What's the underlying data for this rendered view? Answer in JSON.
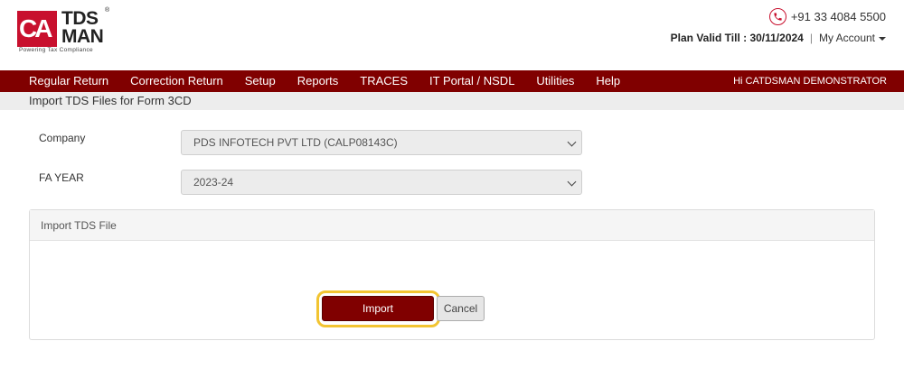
{
  "brand": {
    "logo_ca": "CA",
    "logo_tds": "TDS",
    "logo_man": "MAN",
    "logo_reg": "®",
    "tagline": "Powering Tax Compliance",
    "color": "#c8102e"
  },
  "header": {
    "phone": "+91 33 4084 5500",
    "plan_valid_label": "Plan Valid Till : 30/11/2024",
    "separator": "|",
    "my_account": "My Account"
  },
  "nav": {
    "items": [
      {
        "label": "Regular Return"
      },
      {
        "label": "Correction Return"
      },
      {
        "label": "Setup"
      },
      {
        "label": "Reports"
      },
      {
        "label": "TRACES"
      },
      {
        "label": "IT Portal / NSDL"
      },
      {
        "label": "Utilities"
      },
      {
        "label": "Help"
      }
    ],
    "greeting": "Hi CATDSMAN DEMONSTRATOR",
    "bg_color": "#800000"
  },
  "page": {
    "title": "Import TDS Files for Form 3CD"
  },
  "form": {
    "company_label": "Company",
    "company_value": "PDS INFOTECH PVT LTD (CALP08143C)",
    "fa_year_label": "FA YEAR",
    "fa_year_value": "2023-24"
  },
  "panel": {
    "title": "Import TDS File",
    "import_label": "Import",
    "cancel_label": "Cancel",
    "highlight_color": "#f2c431"
  }
}
